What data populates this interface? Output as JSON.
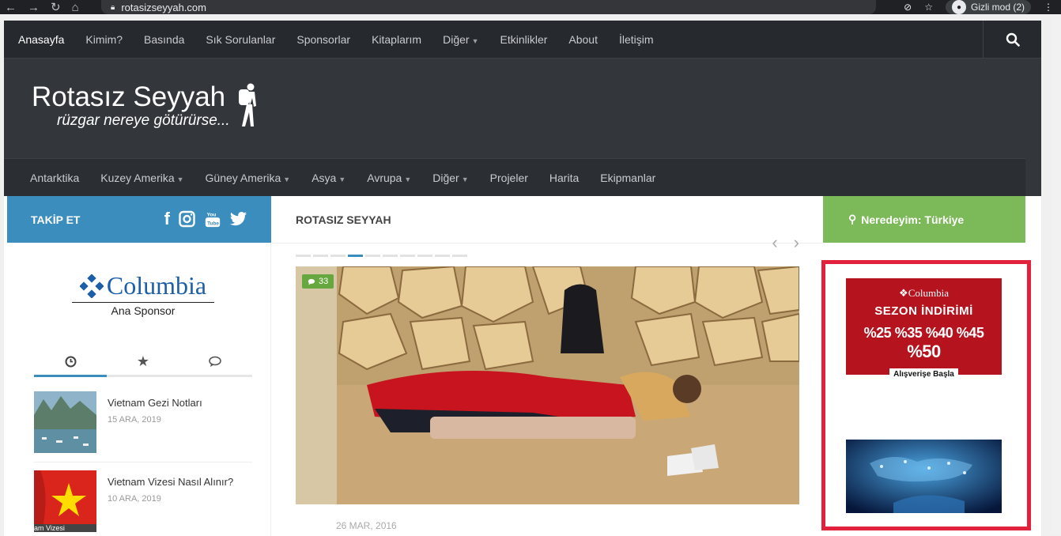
{
  "browser": {
    "url": "rotasizseyyah.com",
    "incognito_label": "Gizli mod (2)"
  },
  "top_nav": {
    "items": [
      "Anasayfa",
      "Kimim?",
      "Basında",
      "Sık Sorulanlar",
      "Sponsorlar",
      "Kitaplarım",
      "Diğer",
      "Etkinlikler",
      "About",
      "İletişim"
    ],
    "active": "Anasayfa"
  },
  "header": {
    "title": "Rotasız Seyyah",
    "tagline": "rüzgar nereye götürürse..."
  },
  "sub_nav": {
    "items": [
      "Antarktika",
      "Kuzey Amerika",
      "Güney Amerika",
      "Asya",
      "Avrupa",
      "Diğer",
      "Projeler",
      "Harita",
      "Ekipmanlar"
    ]
  },
  "left": {
    "follow_label": "TAKİP ET",
    "social_icons": [
      "facebook-icon",
      "instagram-icon",
      "youtube-icon",
      "twitter-icon"
    ],
    "sponsor_brand": "Columbia",
    "sponsor_sub": "Ana Sponsor",
    "tabs": [
      "clock-icon",
      "star-icon",
      "comments-icon"
    ],
    "posts": [
      {
        "title": "Vietnam Gezi Notları",
        "date": "15 ARA, 2019"
      },
      {
        "title": "Vietnam Vizesi Nasıl Alınır?",
        "date": "10 ARA, 2019"
      }
    ],
    "thumb_caption": "am Vizesi"
  },
  "middle": {
    "heading": "ROTASIZ SEYYAH",
    "comment_count": "33",
    "date": "26 MAR, 2016",
    "slider_pages": 10,
    "slider_active": 4
  },
  "right": {
    "location_label": "Neredeyim: Türkiye",
    "ad": {
      "brand": "Columbia",
      "title": "SEZON İNDİRİMİ",
      "percents": [
        "%25",
        "%35",
        "%40",
        "%45",
        "%50"
      ],
      "button": "Alışverişe Başla"
    }
  },
  "colors": {
    "follow_blue": "#3b8dbd",
    "location_green": "#7cb959",
    "highlight_red": "#e3213d",
    "ad_red": "#b5141f",
    "site_dark": "#33363b"
  }
}
